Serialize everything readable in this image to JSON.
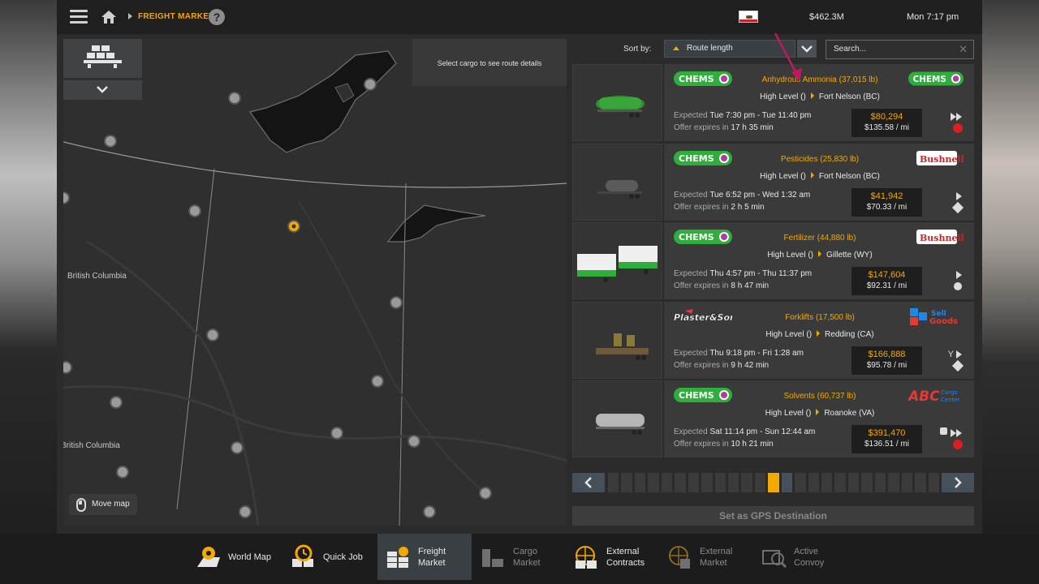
{
  "topbar": {
    "breadcrumb": "FREIGHT MARKET",
    "help": "?",
    "money": "$462.3M",
    "clock": "Mon 7:17 pm"
  },
  "map": {
    "tooltip": "Select cargo to see route details",
    "labels": [
      "British Columbia",
      "British Columbia"
    ],
    "move_map": "Move map"
  },
  "sort": {
    "label": "Sort by:",
    "value": "Route length",
    "search_placeholder": "Search..."
  },
  "jobs": [
    {
      "source_company": "CHEMSO",
      "cargo": "Anhydrous Ammonia (37,015 lb)",
      "destination_company": "CHEMSO",
      "origin": "High Level ()",
      "destination": "Fort Nelson (BC)",
      "expected_label": "Expected",
      "expected": "Tue 7:30 pm - Tue 11:40 pm",
      "expires_label": "Offer expires in",
      "expires": "17 h 35 min",
      "price": "$80,294",
      "per_mile": "$135.58 / mi"
    },
    {
      "source_company": "CHEMSO",
      "cargo": "Pesticides (25,830 lb)",
      "destination_company": "Bushnell",
      "origin": "High Level ()",
      "destination": "Fort Nelson (BC)",
      "expected_label": "Expected",
      "expected": "Tue 6:52 pm - Wed 1:32 am",
      "expires_label": "Offer expires in",
      "expires": "2 h 5 min",
      "price": "$41,942",
      "per_mile": "$70.33 / mi"
    },
    {
      "source_company": "CHEMSO",
      "cargo": "Fertilizer (44,880 lb)",
      "destination_company": "Bushnell",
      "origin": "High Level ()",
      "destination": "Gillette (WY)",
      "expected_label": "Expected",
      "expected": "Thu 4:57 pm - Thu 11:37 pm",
      "expires_label": "Offer expires in",
      "expires": "8 h 47 min",
      "price": "$147,604",
      "per_mile": "$92.31 / mi"
    },
    {
      "source_company": "Plaster&Sons",
      "cargo": "Forklifts (17,500 lb)",
      "destination_company": "Sell Goods",
      "origin": "High Level ()",
      "destination": "Redding (CA)",
      "expected_label": "Expected",
      "expected": "Thu 9:18 pm - Fri 1:28 am",
      "expires_label": "Offer expires in",
      "expires": "9 h 42 min",
      "price": "$166,888",
      "per_mile": "$95.78 / mi"
    },
    {
      "source_company": "CHEMSO",
      "cargo": "Solvents (60,737 lb)",
      "destination_company": "ABC Cargo Center",
      "origin": "High Level ()",
      "destination": "Roanoke (VA)",
      "expected_label": "Expected",
      "expected": "Sat 11:14 pm - Sun 12:44 am",
      "expires_label": "Offer expires in",
      "expires": "10 h 21 min",
      "price": "$391,470",
      "per_mile": "$136.51 / mi"
    }
  ],
  "pagination": {
    "total": 25,
    "current": 13
  },
  "gps_button": "Set as GPS Destination",
  "nav": {
    "world_map": "World Map",
    "quick_job": "Quick Job",
    "freight_market_1": "Freight",
    "freight_market_2": "Market",
    "cargo_market_1": "Cargo",
    "cargo_market_2": "Market",
    "external_contracts_1": "External",
    "external_contracts_2": "Contracts",
    "external_market_1": "External",
    "external_market_2": "Market",
    "active_convoy_1": "Active",
    "active_convoy_2": "Convoy"
  },
  "colors": {
    "accent": "#f2a900",
    "chemso_green": "#2fae3b",
    "red": "#d72020",
    "pink_arrow": "#c2185b"
  }
}
